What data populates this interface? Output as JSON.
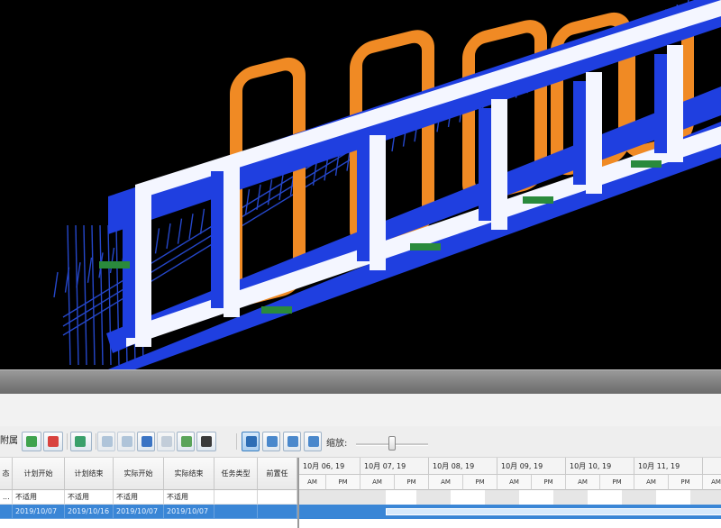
{
  "toolbar": {
    "mode_dropdown": "附属",
    "zoom_label": "缩放:",
    "icons": [
      "refresh-icon",
      "link-icon",
      "chart-down-icon",
      "copy-icon",
      "paste-icon",
      "indent-icon",
      "outdent-icon",
      "check-icon",
      "column-menu-icon",
      "view-day-icon",
      "view-week-icon",
      "view-month-icon",
      "view-year-icon"
    ],
    "zoom_level": 0.5
  },
  "table": {
    "columns": [
      "态",
      "计划开始",
      "计划结束",
      "实际开始",
      "实际结束",
      "任务类型",
      "前置任"
    ],
    "rows": [
      [
        "...",
        "不适用",
        "不适用",
        "不适用",
        "不适用",
        "",
        ""
      ],
      [
        "",
        "2019/10/07",
        "2019/10/16",
        "2019/10/07",
        "2019/10/07",
        "",
        ""
      ]
    ]
  },
  "gantt": {
    "days": [
      "10月 06, 19",
      "10月 07, 19",
      "10月 08, 19",
      "10月 09, 19",
      "10月 10, 19",
      "10月 11, 19",
      ""
    ],
    "am": "AM",
    "pm": "PM"
  },
  "colors": {
    "selection": "#3a86d6",
    "model_blue": "#1f3fe0",
    "model_orange": "#f08a24",
    "model_white": "#f4f6ff"
  }
}
